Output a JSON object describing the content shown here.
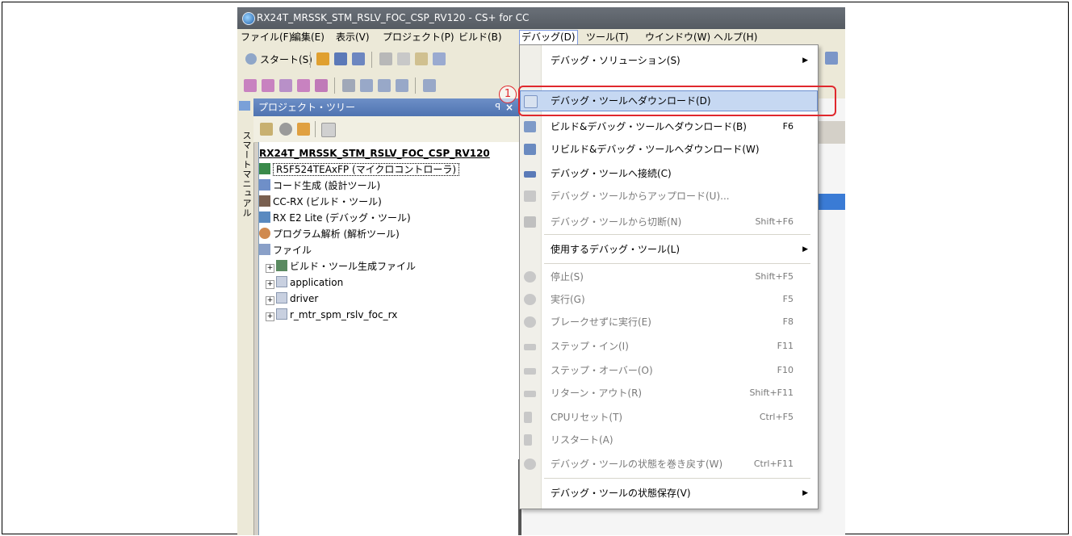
{
  "window": {
    "title": "RX24T_MRSSK_STM_RSLV_FOC_CSP_RV120 - CS+ for CC"
  },
  "menubar": {
    "items": [
      "ファイル(F)",
      "編集(E)",
      "表示(V)",
      "プロジェクト(P)",
      "ビルド(B)",
      "デバッグ(D)",
      "ツール(T)",
      "ウインドウ(W)",
      "ヘルプ(H)"
    ],
    "active": "デバッグ(D)"
  },
  "toolbar": {
    "start_label": "スタート(S)"
  },
  "side_tab": {
    "label": "スマートマニュアル"
  },
  "project_tree": {
    "title": "プロジェクト・ツリー",
    "pin": "ꟼ",
    "close": "×",
    "root": "RX24T_MRSSK_STM_RSLV_FOC_CSP_RV120",
    "nodes": [
      "R5F524TEAxFP (マイクロコントローラ)",
      "コード生成 (設計ツール)",
      "CC-RX (ビルド・ツール)",
      "RX E2 Lite (デバッグ・ツール)",
      "プログラム解析 (解析ツール)",
      "ファイル",
      "ビルド・ツール生成ファイル",
      "application",
      "driver",
      "r_mtr_spm_rslv_foc_rx"
    ]
  },
  "debug_menu": {
    "items": [
      {
        "label": "デバッグ・ソリューション(S)",
        "shortcut": "",
        "submenu": true,
        "disabled": false
      },
      {
        "label": "デバッグ・ツールへダウンロード(D)",
        "shortcut": "",
        "submenu": false,
        "disabled": false,
        "highlighted": true
      },
      {
        "label": "ビルド&デバッグ・ツールへダウンロード(B)",
        "shortcut": "F6",
        "submenu": false,
        "disabled": false
      },
      {
        "label": "リビルド&デバッグ・ツールへダウンロード(W)",
        "shortcut": "",
        "submenu": false,
        "disabled": false
      },
      {
        "label": "デバッグ・ツールへ接続(C)",
        "shortcut": "",
        "submenu": false,
        "disabled": false
      },
      {
        "label": "デバッグ・ツールからアップロード(U)...",
        "shortcut": "",
        "submenu": false,
        "disabled": true
      },
      {
        "label": "デバッグ・ツールから切断(N)",
        "shortcut": "Shift+F6",
        "submenu": false,
        "disabled": true
      },
      {
        "label": "使用するデバッグ・ツール(L)",
        "shortcut": "",
        "submenu": true,
        "disabled": false
      },
      {
        "label": "停止(S)",
        "shortcut": "Shift+F5",
        "submenu": false,
        "disabled": true
      },
      {
        "label": "実行(G)",
        "shortcut": "F5",
        "submenu": false,
        "disabled": true
      },
      {
        "label": "ブレークせずに実行(E)",
        "shortcut": "F8",
        "submenu": false,
        "disabled": true
      },
      {
        "label": "ステップ・イン(I)",
        "shortcut": "F11",
        "submenu": false,
        "disabled": true
      },
      {
        "label": "ステップ・オーバー(O)",
        "shortcut": "F10",
        "submenu": false,
        "disabled": true
      },
      {
        "label": "リターン・アウト(R)",
        "shortcut": "Shift+F11",
        "submenu": false,
        "disabled": true
      },
      {
        "label": "CPUリセット(T)",
        "shortcut": "Ctrl+F5",
        "submenu": false,
        "disabled": true
      },
      {
        "label": "リスタート(A)",
        "shortcut": "",
        "submenu": false,
        "disabled": true
      },
      {
        "label": "デバッグ・ツールの状態を巻き戻す(W)",
        "shortcut": "Ctrl+F11",
        "submenu": false,
        "disabled": true
      },
      {
        "label": "デバッグ・ツールの状態保存(V)",
        "shortcut": "",
        "submenu": true,
        "disabled": false
      }
    ]
  },
  "callout": {
    "number": "1"
  },
  "colors": {
    "callout": "#e0282d",
    "highlight": "#c6d8f2",
    "panel_title": "#4f73b1"
  }
}
